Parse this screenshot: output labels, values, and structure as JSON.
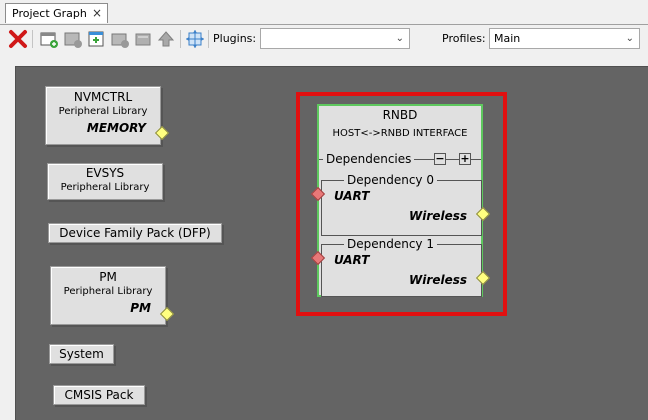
{
  "tab": {
    "title": "Project Graph",
    "close": "×"
  },
  "toolbar": {
    "plugins_label": "Plugins:",
    "plugins_value": "",
    "profiles_label": "Profiles:",
    "profiles_value": "Main",
    "icons": [
      "delete-icon",
      "new-component-icon",
      "component-icon",
      "add-component-icon",
      "module-icon",
      "folder-icon",
      "up-arrow-icon",
      "fit-view-icon"
    ]
  },
  "nodes": [
    {
      "title": "NVMCTRL",
      "subtitle": "Peripheral Library",
      "category": "MEMORY"
    },
    {
      "title": "EVSYS",
      "subtitle": "Peripheral Library"
    },
    {
      "title": "Device Family Pack (DFP)"
    },
    {
      "title": "PM",
      "subtitle": "Peripheral Library",
      "category": "PM"
    },
    {
      "title": "System"
    },
    {
      "title": "CMSIS Pack"
    }
  ],
  "rnbd": {
    "title": "RNBD",
    "subtitle": "HOST<->RNBD INTERFACE",
    "dependencies_label": "Dependencies",
    "collapse": "−",
    "expand": "+",
    "deps": [
      {
        "label": "Dependency 0",
        "input": "UART",
        "output": "Wireless"
      },
      {
        "label": "Dependency 1",
        "input": "UART",
        "output": "Wireless"
      }
    ]
  },
  "colors": {
    "canvas": "#646464",
    "highlight": "#e01010",
    "selected_border": "#5ec85e"
  }
}
